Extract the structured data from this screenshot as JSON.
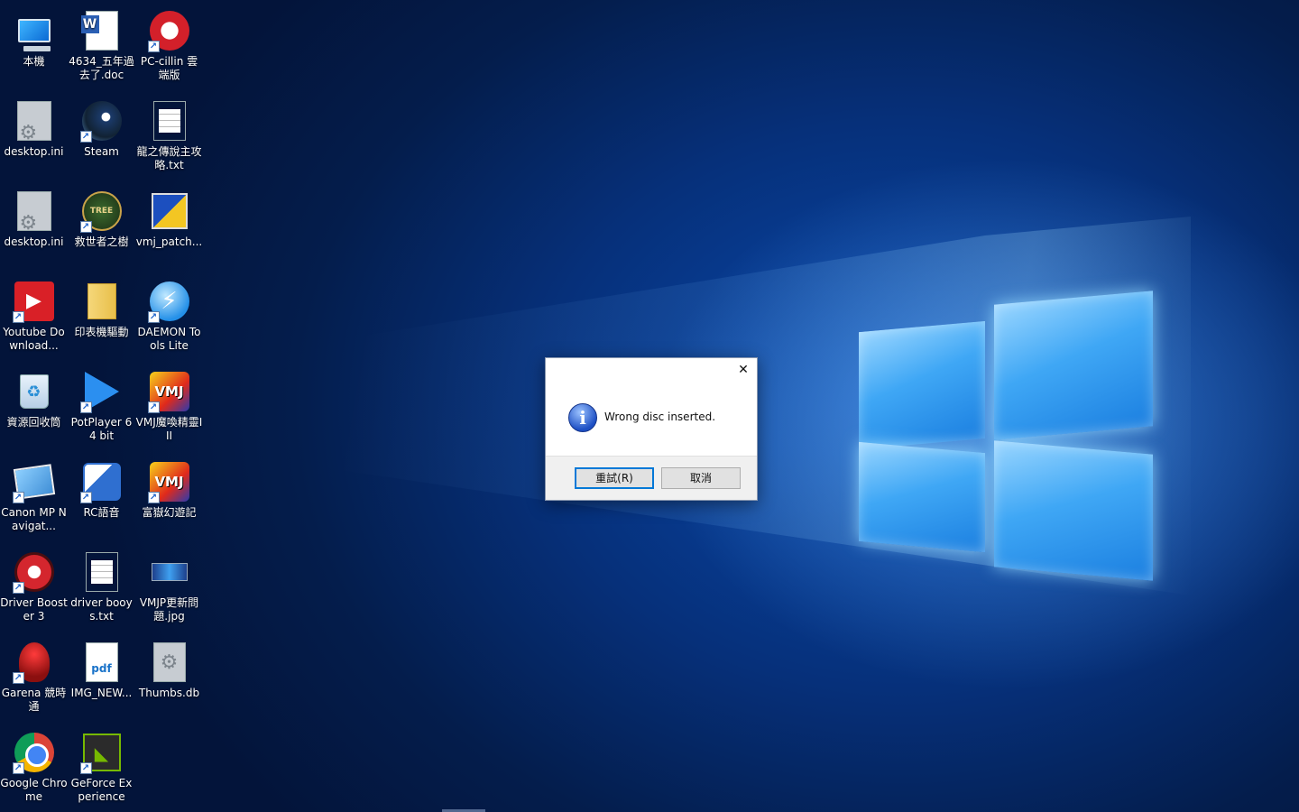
{
  "desktop": {
    "icons": [
      {
        "label": "本機",
        "icon": "computer-icon",
        "shortcut": false
      },
      {
        "label": "4634_五年過去了.doc",
        "icon": "word-document-icon",
        "shortcut": false
      },
      {
        "label": "PC-cillin 雲端版",
        "icon": "pc-cillin-icon",
        "shortcut": true
      },
      {
        "label": "desktop.ini",
        "icon": "settings-file-icon",
        "shortcut": false
      },
      {
        "label": "Steam",
        "icon": "steam-icon",
        "shortcut": true
      },
      {
        "label": "龍之傳說主攻略.txt",
        "icon": "text-file-icon",
        "shortcut": false
      },
      {
        "label": "desktop.ini",
        "icon": "settings-file-icon",
        "shortcut": false
      },
      {
        "label": "救世者之樹",
        "icon": "tree-of-savior-icon",
        "shortcut": true
      },
      {
        "label": "vmj_patch...",
        "icon": "installer-icon",
        "shortcut": false
      },
      {
        "label": "Youtube Download...",
        "icon": "youtube-downloader-icon",
        "shortcut": true
      },
      {
        "label": "印表機驅動",
        "icon": "folder-icon",
        "shortcut": false
      },
      {
        "label": "DAEMON Tools Lite",
        "icon": "daemon-tools-icon",
        "shortcut": true
      },
      {
        "label": "資源回收筒",
        "icon": "recycle-bin-icon",
        "shortcut": false
      },
      {
        "label": "PotPlayer 64 bit",
        "icon": "potplayer-icon",
        "shortcut": true
      },
      {
        "label": "VMJ魔喚精靈III",
        "icon": "vmj-game-icon",
        "shortcut": true
      },
      {
        "label": "Canon MP Navigat...",
        "icon": "canon-navigator-icon",
        "shortcut": true
      },
      {
        "label": "RC語音",
        "icon": "rc-voice-icon",
        "shortcut": true
      },
      {
        "label": "富嶽幻遊記",
        "icon": "vmj-game-icon",
        "shortcut": true
      },
      {
        "label": "Driver Booster 3",
        "icon": "driver-booster-icon",
        "shortcut": true
      },
      {
        "label": "driver booys.txt",
        "icon": "text-file-icon",
        "shortcut": false
      },
      {
        "label": "VMJP更新問題.jpg",
        "icon": "image-file-icon",
        "shortcut": false
      },
      {
        "label": "Garena 競時通",
        "icon": "garena-icon",
        "shortcut": true
      },
      {
        "label": "IMG_NEW...",
        "icon": "pdf-file-icon",
        "shortcut": false
      },
      {
        "label": "Thumbs.db",
        "icon": "database-file-icon",
        "shortcut": false
      },
      {
        "label": "Google Chrome",
        "icon": "chrome-icon",
        "shortcut": true
      },
      {
        "label": "GeForce Experience",
        "icon": "geforce-icon",
        "shortcut": true
      }
    ]
  },
  "dialog": {
    "message": "Wrong disc inserted.",
    "close_glyph": "✕",
    "info_glyph": "i",
    "retry_label": "重試(R)",
    "cancel_label": "取消"
  },
  "icon_glyphs": {
    "pc-cillin": "◉",
    "daemon": "⚡",
    "youtube": "▶",
    "recycle": "♻",
    "vmj": "VMJ",
    "pdf": "pdf",
    "thumbs": "⚙",
    "geforce": "◣",
    "tree": "TREE",
    "shortcut": "↗"
  }
}
